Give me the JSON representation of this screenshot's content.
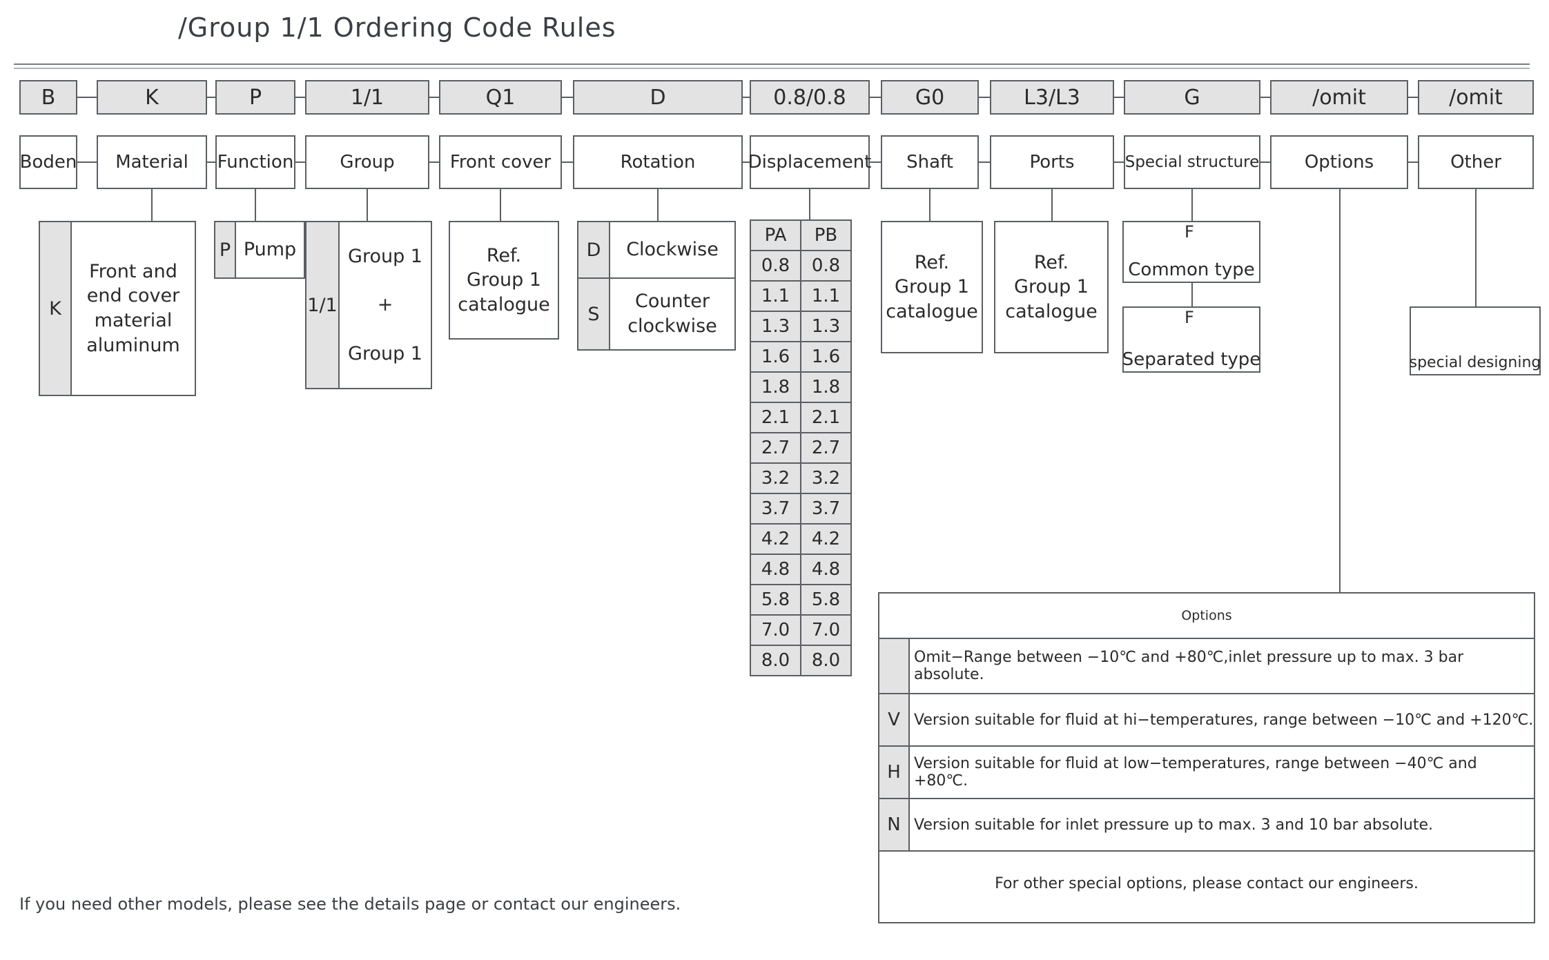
{
  "title": "/Group 1/1 Ordering Code Rules",
  "code_row": [
    {
      "code": "B",
      "name": "Boden"
    },
    {
      "code": "K",
      "name": "Material"
    },
    {
      "code": "P",
      "name": "Function"
    },
    {
      "code": "1/1",
      "name": "Group"
    },
    {
      "code": "Q1",
      "name": "Front cover"
    },
    {
      "code": "D",
      "name": "Rotation"
    },
    {
      "code": "0.8/0.8",
      "name": "Displacement"
    },
    {
      "code": "G0",
      "name": "Shaft"
    },
    {
      "code": "L3/L3",
      "name": "Ports"
    },
    {
      "code": "G",
      "name": "Special structure"
    },
    {
      "code": "/omit",
      "name": "Options"
    },
    {
      "code": "/omit",
      "name": "Other"
    }
  ],
  "material": {
    "key": "K",
    "lines": [
      "Front and",
      "end cover",
      "material",
      "aluminum"
    ]
  },
  "function": {
    "key": "P",
    "label": "Pump"
  },
  "group": {
    "key": "1/1",
    "lines": [
      "Group 1",
      "+",
      "Group 1"
    ]
  },
  "front_cover": {
    "lines": [
      "Ref.",
      "Group 1",
      "catalogue"
    ]
  },
  "rotation": [
    {
      "key": "D",
      "label": "Clockwise"
    },
    {
      "key": "S",
      "label": "Counter\nclockwise"
    }
  ],
  "displacement": {
    "headers": [
      "PA",
      "PB"
    ],
    "rows": [
      [
        "0.8",
        "0.8"
      ],
      [
        "1.1",
        "1.1"
      ],
      [
        "1.3",
        "1.3"
      ],
      [
        "1.6",
        "1.6"
      ],
      [
        "1.8",
        "1.8"
      ],
      [
        "2.1",
        "2.1"
      ],
      [
        "2.7",
        "2.7"
      ],
      [
        "3.2",
        "3.2"
      ],
      [
        "3.7",
        "3.7"
      ],
      [
        "4.2",
        "4.2"
      ],
      [
        "4.8",
        "4.8"
      ],
      [
        "5.8",
        "5.8"
      ],
      [
        "7.0",
        "7.0"
      ],
      [
        "8.0",
        "8.0"
      ]
    ]
  },
  "shaft": {
    "lines": [
      "Ref.",
      "Group 1",
      "catalogue"
    ]
  },
  "ports": {
    "lines": [
      "Ref.",
      "Group 1",
      "catalogue"
    ]
  },
  "special_structure": [
    {
      "key": "F",
      "label": "Common type"
    },
    {
      "key": "F",
      "label": "Separated type"
    }
  ],
  "other": {
    "label": "special designing"
  },
  "options_table": {
    "heading": "Options",
    "rows": [
      {
        "code": "",
        "text": "Omit−Range between −10℃ and +80℃,inlet pressure up to max. 3 bar absolute."
      },
      {
        "code": "V",
        "text": "Version suitable for fluid at hi−temperatures, range between −10℃ and +120℃."
      },
      {
        "code": "H",
        "text": "Version suitable for fluid at low−temperatures, range between −40℃ and +80℃."
      },
      {
        "code": "N",
        "text": "Version suitable for inlet pressure up to max. 3 and 10 bar absolute."
      }
    ],
    "footer": "For other special options, please contact our engineers."
  },
  "footnote": "If you need other models, please see the details page or contact our engineers."
}
